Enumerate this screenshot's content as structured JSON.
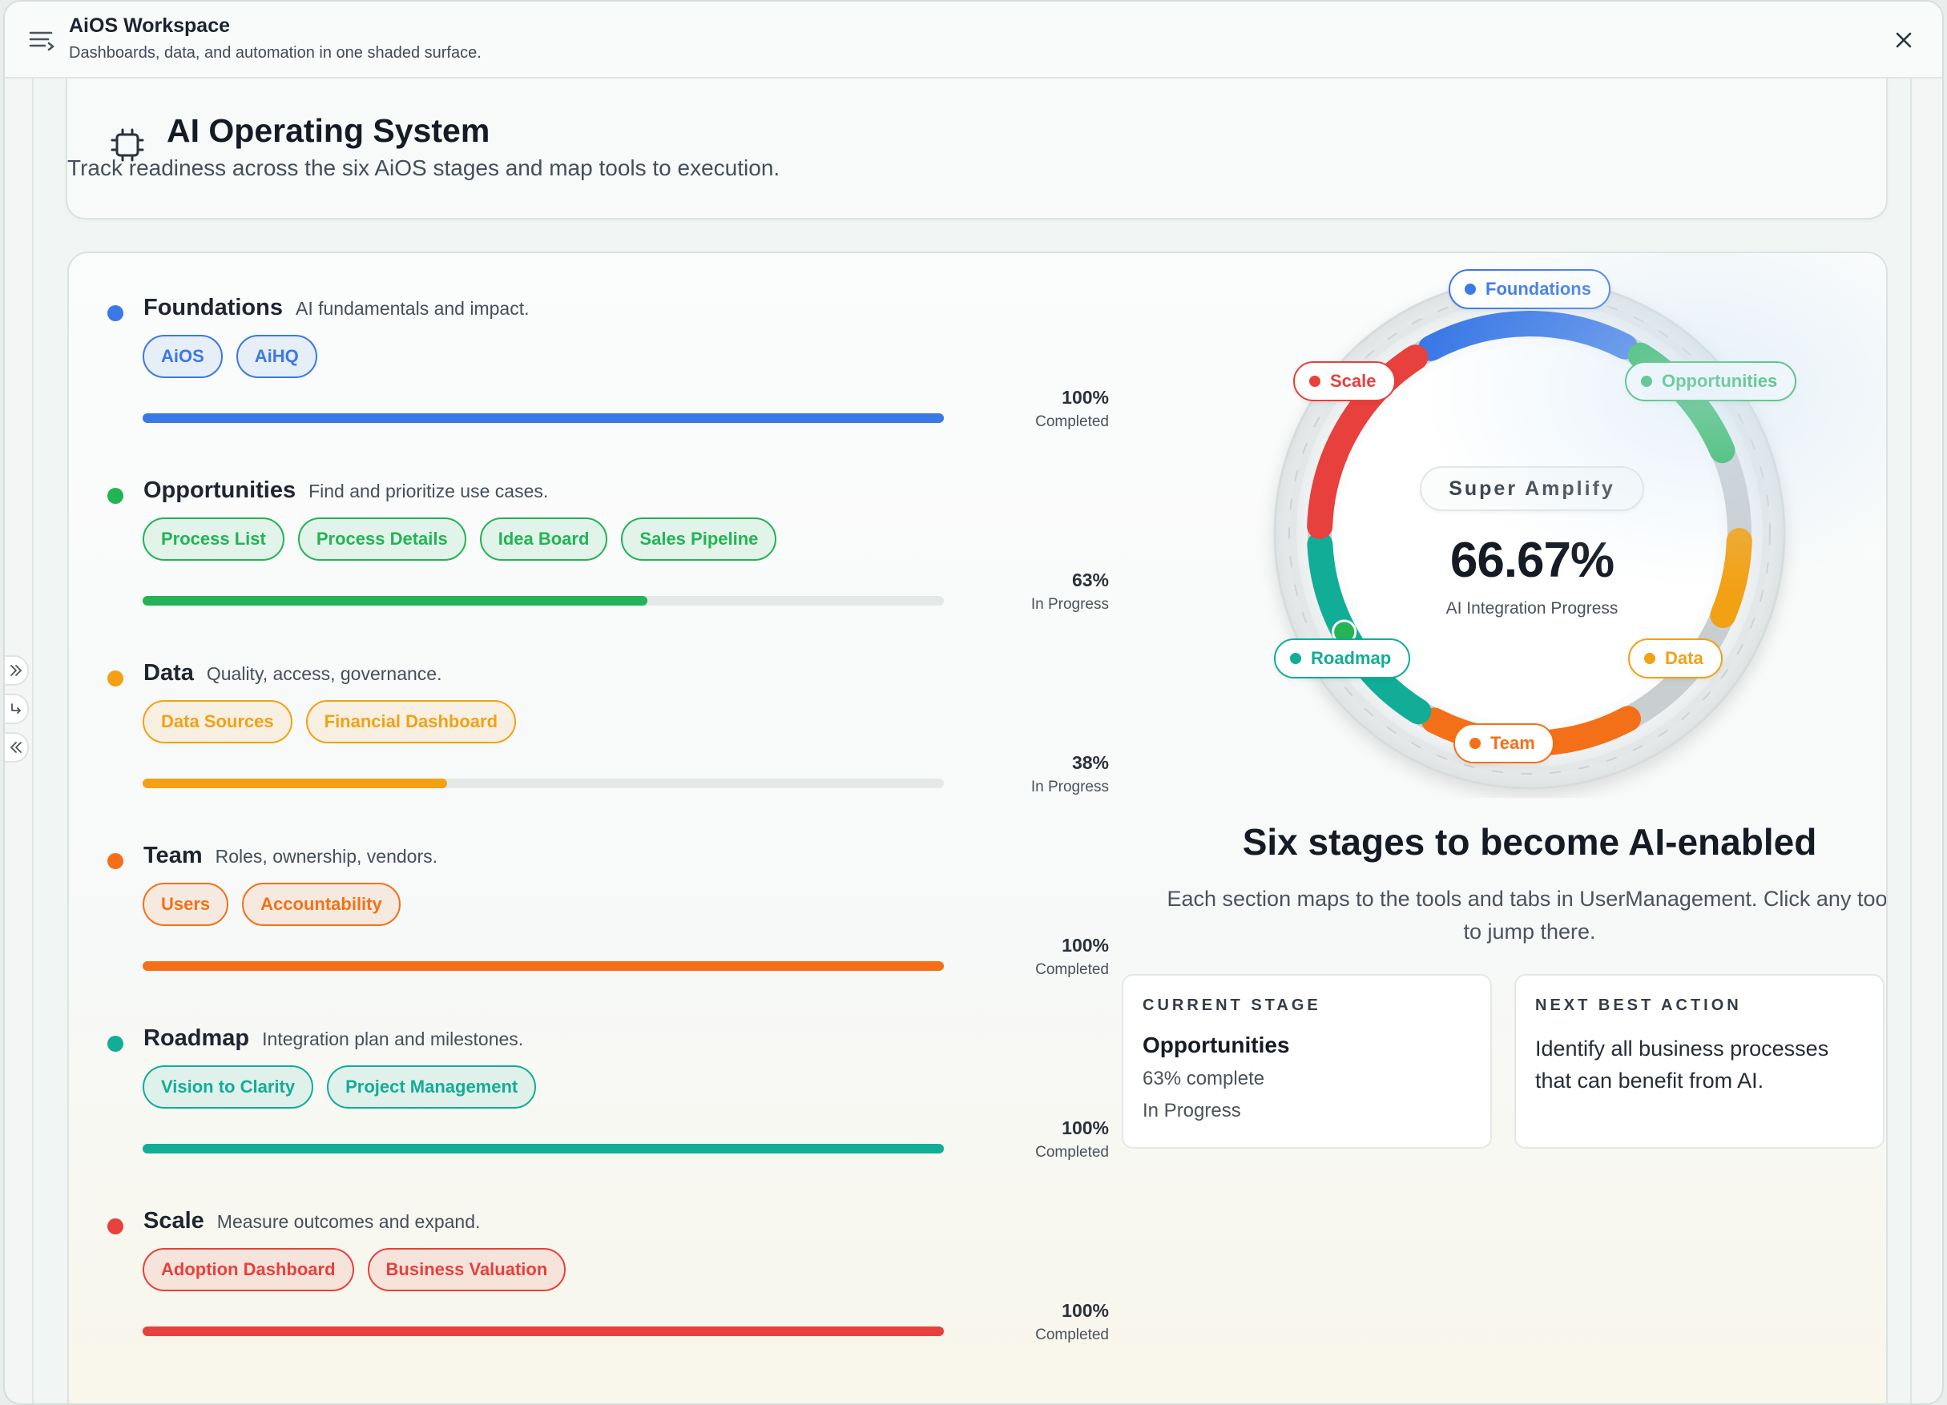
{
  "titlebar": {
    "title": "AiOS Workspace",
    "subtitle": "Dashboards, data, and automation in one shaded surface."
  },
  "header": {
    "title": "AI Operating System",
    "subtitle": "Track readiness across the six AiOS stages and map tools to execution."
  },
  "stages": [
    {
      "name": "Foundations",
      "desc": "AI fundamentals and impact.",
      "color": "#3a78e6",
      "tags": [
        "AiOS",
        "AiHQ"
      ],
      "progress": 100,
      "percent": "100%",
      "status": "Completed"
    },
    {
      "name": "Opportunities",
      "desc": "Find and prioritize use cases.",
      "color": "#22b455",
      "tags": [
        "Process List",
        "Process Details",
        "Idea Board",
        "Sales Pipeline"
      ],
      "progress": 63,
      "percent": "63%",
      "status": "In Progress"
    },
    {
      "name": "Data",
      "desc": "Quality, access, governance.",
      "color": "#f2a114",
      "tags": [
        "Data Sources",
        "Financial Dashboard"
      ],
      "progress": 38,
      "percent": "38%",
      "status": "In Progress"
    },
    {
      "name": "Team",
      "desc": "Roles, ownership, vendors.",
      "color": "#f47018",
      "tags": [
        "Users",
        "Accountability"
      ],
      "progress": 100,
      "percent": "100%",
      "status": "Completed"
    },
    {
      "name": "Roadmap",
      "desc": "Integration plan and milestones.",
      "color": "#12ad96",
      "tags": [
        "Vision to Clarity",
        "Project Management"
      ],
      "progress": 100,
      "percent": "100%",
      "status": "Completed"
    },
    {
      "name": "Scale",
      "desc": "Measure outcomes and expand.",
      "color": "#e8403c",
      "tags": [
        "Adoption Dashboard",
        "Business Valuation"
      ],
      "progress": 100,
      "percent": "100%",
      "status": "Completed"
    }
  ],
  "ring": {
    "mode": "Super Amplify",
    "value": "66.67%",
    "label": "AI Integration Progress",
    "badges": [
      "Foundations",
      "Opportunities",
      "Data",
      "Team",
      "Roadmap",
      "Scale"
    ]
  },
  "summary": {
    "title": "Six stages to become AI-enabled",
    "description": "Each section maps to the tools and tabs in UserManagement. Click any tool to jump there."
  },
  "current_stage": {
    "heading": "CURRENT STAGE",
    "name": "Opportunities",
    "complete": "63% complete",
    "status": "In Progress"
  },
  "next_action": {
    "heading": "NEXT BEST ACTION",
    "text": "Identify all business processes that can benefit from AI."
  },
  "colors": {
    "ring_track": "#c9ced1",
    "tag_fill_alpha": "1a"
  },
  "icons": [
    "menu-icon",
    "close-icon",
    "chip-icon",
    "expand-right-icon",
    "return-icon",
    "collapse-left-icon"
  ]
}
